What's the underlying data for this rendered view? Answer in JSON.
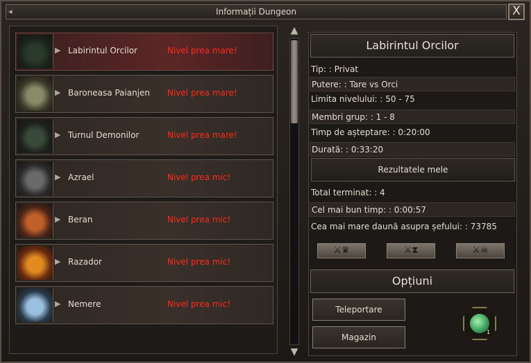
{
  "window": {
    "title": "Informații Dungeon",
    "close_label": "X",
    "title_arrow": "◂"
  },
  "dungeons": [
    {
      "name": "Labirintul Orcilor",
      "status": "Nivel prea mare!",
      "selected": true
    },
    {
      "name": "Baroneasa Paianjen",
      "status": "Nivel prea mare!"
    },
    {
      "name": "Turnul Demonilor",
      "status": "Nivel prea mare!"
    },
    {
      "name": "Azrael",
      "status": "Nivel prea mic!"
    },
    {
      "name": "Beran",
      "status": "Nivel prea mic!"
    },
    {
      "name": "Razador",
      "status": "Nivel prea mic!"
    },
    {
      "name": "Nemere",
      "status": "Nivel prea mic!"
    }
  ],
  "details": {
    "title": "Labirintul Orcilor",
    "type": "Tip: : Privat",
    "power": "Putere: : Tare vs Orci",
    "level_limit": "Limita nivelului: : 50 - 75",
    "group_members": "Membri grup: : 1 - 8",
    "wait_time": "Timp de așteptare: : 0:20:00",
    "duration": "Durată: : 0:33:20",
    "results_button": "Rezultatele mele",
    "total_finished": "Total terminat: : 4",
    "best_time": "Cel mai bun timp: : 0:00:57",
    "max_damage": "Cea mai mare daună asupra șefului: : 73785"
  },
  "options": {
    "title": "Opțiuni",
    "teleport_button": "Teleportare",
    "shop_button": "Magazin",
    "item_count": "1"
  },
  "icons": {
    "rank_crown": "⚔♛",
    "rank_time": "⚔⧗",
    "rank_skull": "⚔☠",
    "scroll_up": "▲",
    "scroll_down": "▼",
    "row_arrow": "▶"
  }
}
